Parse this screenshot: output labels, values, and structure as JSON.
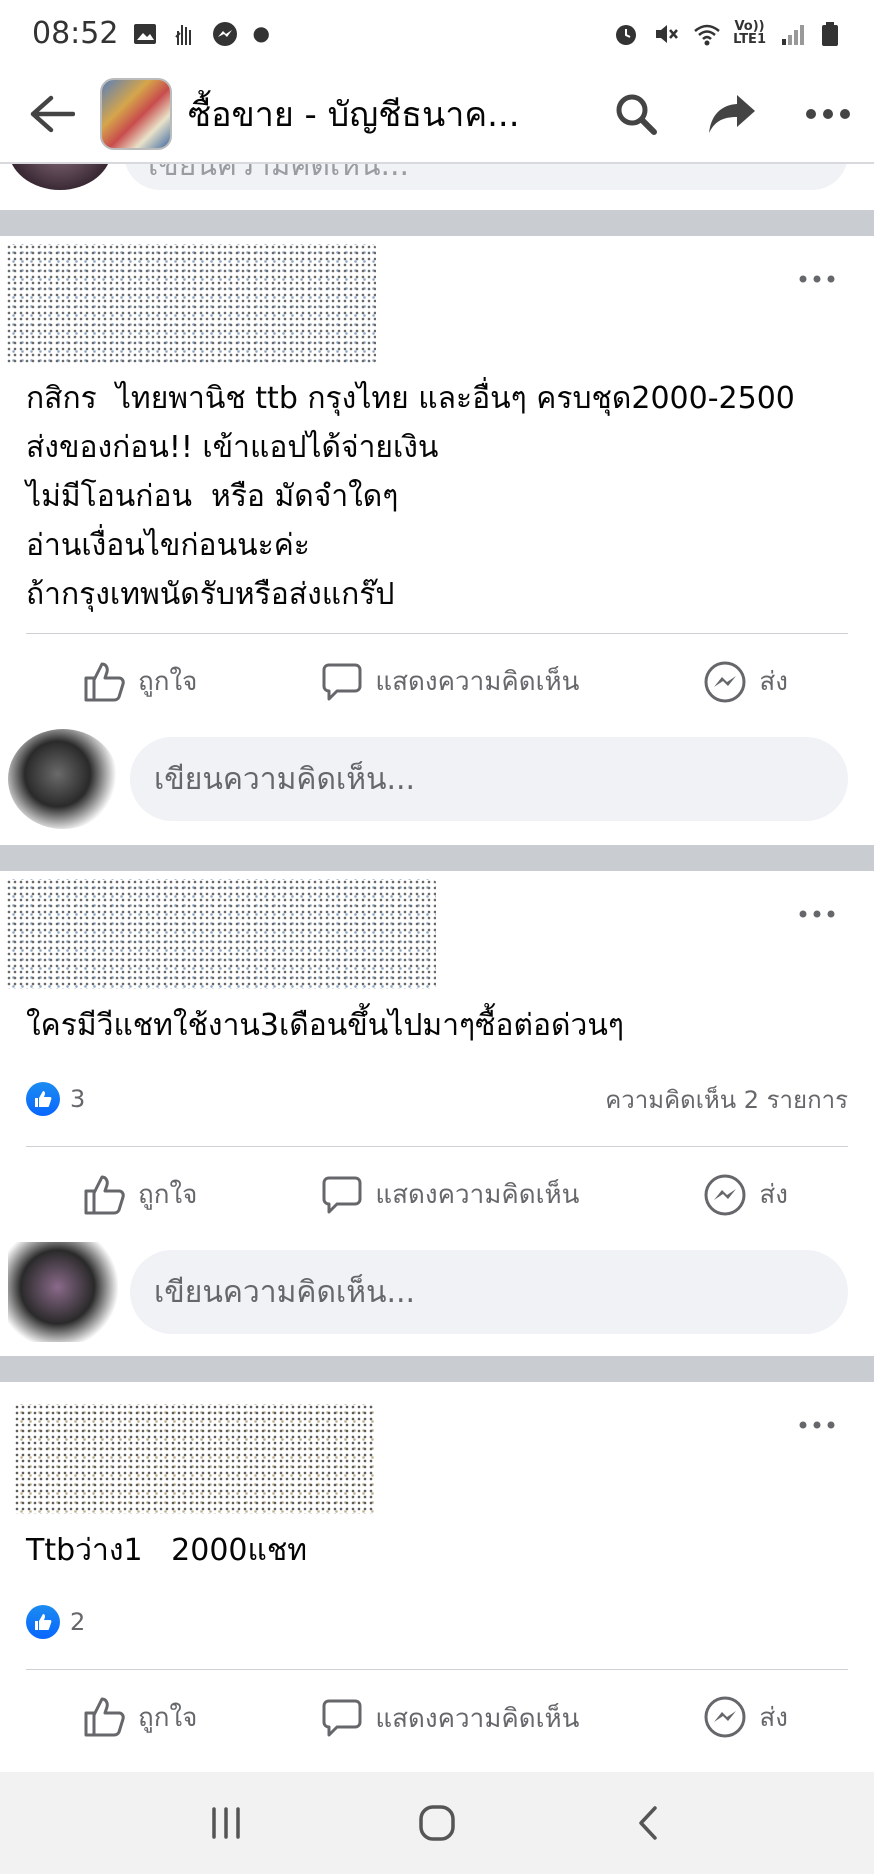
{
  "status_bar": {
    "time": "08:52",
    "network_top": "Vo))",
    "network_bottom": "LTE1"
  },
  "app_bar": {
    "title": "ซื้อขาย - บัญชีธนาค..."
  },
  "comment_placeholder": "เขียนความคิดเห็น...",
  "actions": {
    "like": "ถูกใจ",
    "comment": "แสดงความคิดเห็น",
    "send": "ส่ง"
  },
  "posts": [
    {
      "text": "กสิกร  ไทยพานิช ttb กรุงไทย และอื่นๆ ครบชุด2000-2500\nส่งของก่อน!! เข้าแอปได้จ่ายเงิน\nไม่มีโอนก่อน  หรือ มัดจำใดๆ\nอ่านเงื่อนไขก่อนนะค่ะ\nถ้ากรุงเทพนัดรับหรือส่งแกร๊ป"
    },
    {
      "text": "ใครมีวีแชทใช้งาน3เดือนขึ้นไปมาๆซื้อต่อด่วนๆ",
      "likes": "3",
      "comments": "ความคิดเห็น 2 รายการ"
    },
    {
      "text": "Ttbว่าง1   2000แชท",
      "likes": "2"
    }
  ],
  "colors": {
    "like_blue": "#0866ff",
    "divider": "#c9ccd1",
    "input_bg": "#f0f2f5",
    "secondary_text": "#65676b"
  }
}
